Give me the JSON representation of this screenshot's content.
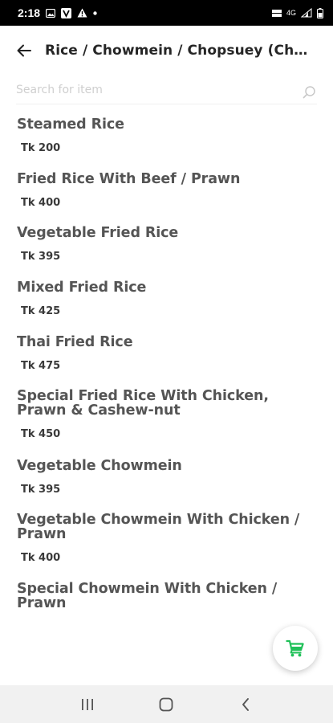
{
  "status_bar": {
    "time": "2:18",
    "signal_label": "4G"
  },
  "header": {
    "title": "Rice / Chowmein / Chopsuey (Chi..."
  },
  "search": {
    "placeholder": "Search for item",
    "value": ""
  },
  "items": [
    {
      "name": "Steamed Rice",
      "price": "Tk 200"
    },
    {
      "name": "Fried Rice With Beef / Prawn",
      "price": "Tk 400"
    },
    {
      "name": "Vegetable Fried Rice",
      "price": "Tk 395"
    },
    {
      "name": "Mixed Fried Rice",
      "price": "Tk 425"
    },
    {
      "name": "Thai Fried Rice",
      "price": "Tk 475"
    },
    {
      "name": "Special Fried Rice With Chicken, Prawn & Cashew-nut",
      "price": "Tk 450"
    },
    {
      "name": "Vegetable Chowmein",
      "price": "Tk 395"
    },
    {
      "name": "Vegetable Chowmein With Chicken / Prawn",
      "price": "Tk 400"
    },
    {
      "name": "Special Chowmein With Chicken / Prawn",
      "price": ""
    }
  ],
  "colors": {
    "accent": "#1fc058",
    "status_bar_bg": "#000000",
    "nav_bar_bg": "#f1f1f1"
  },
  "icons": {
    "back": "arrow-left-icon",
    "search": "search-icon",
    "cart": "cart-icon",
    "nav_recents": "recents-icon",
    "nav_home": "home-icon",
    "nav_back": "chevron-left-icon"
  }
}
